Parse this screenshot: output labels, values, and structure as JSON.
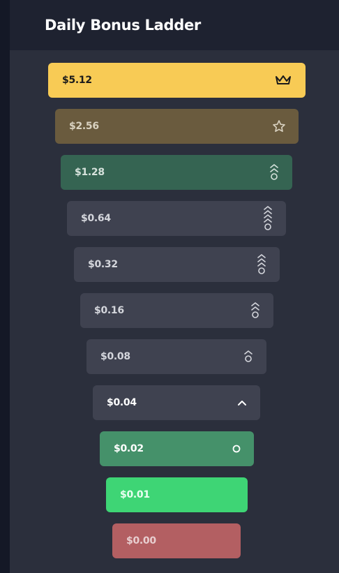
{
  "header": {
    "title": "Daily Bonus Ladder"
  },
  "ladder": [
    {
      "amount": "$5.12",
      "icon": "crown-icon",
      "bg": "#f8cb55",
      "fg": "#1b1b1b",
      "icon_color": "#1b1b1b"
    },
    {
      "amount": "$2.56",
      "icon": "star-icon",
      "bg": "#6a5b3e",
      "fg": "#d9d2c1",
      "icon_color": "#d9d2c1"
    },
    {
      "amount": "$1.28",
      "icon": "chevrons-2-circle-icon",
      "bg": "#356452",
      "fg": "#d6e2dc",
      "icon_color": "#d6e2dc"
    },
    {
      "amount": "$0.64",
      "icon": "chevrons-4-circle-icon",
      "bg": "#3f4250",
      "fg": "#d4d6dc",
      "icon_color": "#d4d6dc"
    },
    {
      "amount": "$0.32",
      "icon": "chevrons-3-circle-icon",
      "bg": "#3f4250",
      "fg": "#d4d6dc",
      "icon_color": "#d4d6dc"
    },
    {
      "amount": "$0.16",
      "icon": "chevrons-2-circle-icon",
      "bg": "#3f4250",
      "fg": "#d4d6dc",
      "icon_color": "#d4d6dc"
    },
    {
      "amount": "$0.08",
      "icon": "chevron-circle-icon",
      "bg": "#3f4250",
      "fg": "#d4d6dc",
      "icon_color": "#d4d6dc"
    },
    {
      "amount": "$0.04",
      "icon": "chevron-up-icon",
      "bg": "#3f4250",
      "fg": "#ffffff",
      "icon_color": "#ffffff"
    },
    {
      "amount": "$0.02",
      "icon": "circle-icon",
      "bg": "#45916a",
      "fg": "#ffffff",
      "icon_color": "#ffffff"
    },
    {
      "amount": "$0.01",
      "icon": "",
      "bg": "#3ed575",
      "fg": "#e9fff1",
      "icon_color": "#e9fff1"
    },
    {
      "amount": "$0.00",
      "icon": "",
      "bg": "#b35f62",
      "fg": "#e8cfd0",
      "icon_color": "#e8cfd0"
    }
  ]
}
